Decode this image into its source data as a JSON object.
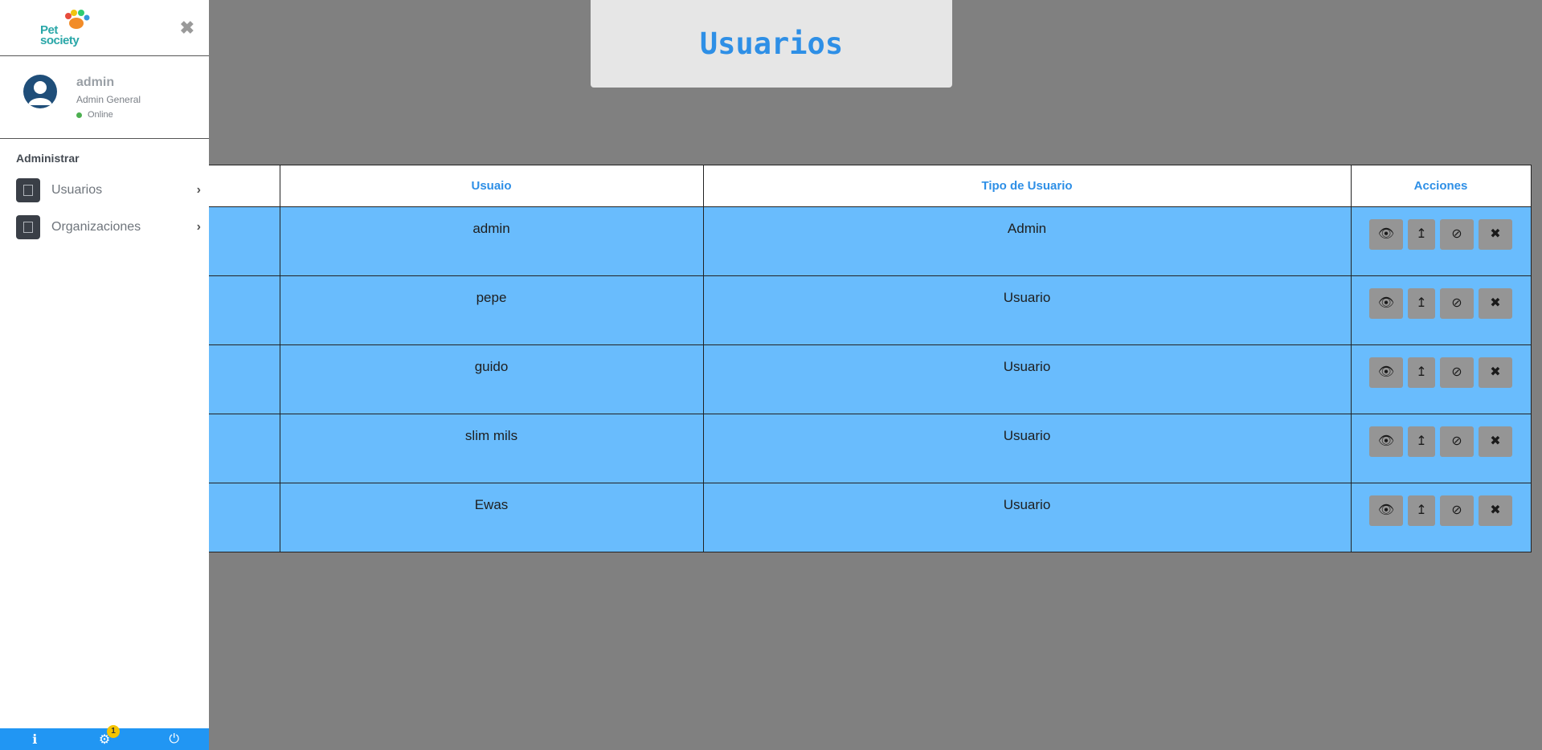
{
  "sidebar": {
    "brand": "Pet society",
    "brand_line1": "Pet",
    "brand_line2": "society",
    "close": "✖",
    "user": {
      "name": "admin",
      "role": "Admin General",
      "status": "Online"
    },
    "section_title": "Administrar",
    "items": [
      {
        "label": "Usuarios",
        "arrow": "›"
      },
      {
        "label": "Organizaciones",
        "arrow": "›"
      }
    ],
    "bottom": {
      "info_icon": "ℹ",
      "settings_icon": "⚙",
      "settings_badge": "1",
      "power_icon": "⏻"
    }
  },
  "page": {
    "title": "Usuarios"
  },
  "table": {
    "headers": [
      "",
      "Usuaio",
      "Tipo de Usuario",
      "Acciones"
    ],
    "rows": [
      {
        "col0": "",
        "user": "admin",
        "type": "Admin"
      },
      {
        "col0": "",
        "user": "pepe",
        "type": "Usuario"
      },
      {
        "col0": "",
        "user": "guido",
        "type": "Usuario"
      },
      {
        "col0": "",
        "user": "slim mils",
        "type": "Usuario"
      },
      {
        "col0": "",
        "user": "Ewas",
        "type": "Usuario"
      }
    ],
    "actions": {
      "view": "👁",
      "promote": "↥",
      "block": "⊘",
      "delete": "✖"
    }
  },
  "colors": {
    "accent": "#2e8fe6",
    "row_bg": "#69bcfd",
    "page_bg": "#808080",
    "bottom_bar": "#2196f3"
  },
  "icons": [
    "eye-icon",
    "promote-icon",
    "block-icon",
    "delete-icon",
    "info-icon",
    "gear-icon",
    "power-icon",
    "user-avatar-icon",
    "document-icon",
    "chevron-right-icon",
    "close-icon"
  ]
}
